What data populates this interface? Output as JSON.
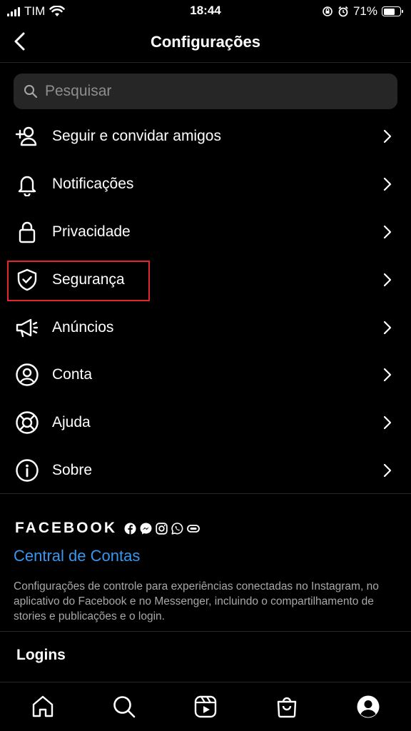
{
  "status_bar": {
    "carrier": "TIM",
    "time": "18:44",
    "battery": "71%",
    "battery_level": 0.71
  },
  "header": {
    "title": "Configurações"
  },
  "search": {
    "placeholder": "Pesquisar"
  },
  "menu": {
    "items": [
      {
        "label": "Seguir e convidar amigos",
        "icon": "add-person-icon"
      },
      {
        "label": "Notificações",
        "icon": "bell-icon"
      },
      {
        "label": "Privacidade",
        "icon": "lock-icon"
      },
      {
        "label": "Segurança",
        "icon": "shield-check-icon"
      },
      {
        "label": "Anúncios",
        "icon": "megaphone-icon"
      },
      {
        "label": "Conta",
        "icon": "account-circle-icon"
      },
      {
        "label": "Ajuda",
        "icon": "lifebuoy-icon"
      },
      {
        "label": "Sobre",
        "icon": "info-icon"
      }
    ]
  },
  "facebook": {
    "wordmark": "FACEBOOK",
    "icons": [
      "facebook-icon",
      "messenger-icon",
      "instagram-icon",
      "whatsapp-icon",
      "portal-icon"
    ],
    "link": "Central de Contas",
    "description": "Configurações de controle para experiências conectadas no Instagram, no aplicativo do Facebook e no Messenger, incluindo o compartilhamento de stories e publicações e o login."
  },
  "logins": {
    "title": "Logins"
  },
  "bottom_nav": [
    "home-icon",
    "search-icon",
    "reels-icon",
    "shop-icon",
    "profile-icon"
  ],
  "colors": {
    "accent_link": "#3897f0",
    "highlight": "#e0262f",
    "background": "#000000",
    "search_bg": "#262626"
  }
}
